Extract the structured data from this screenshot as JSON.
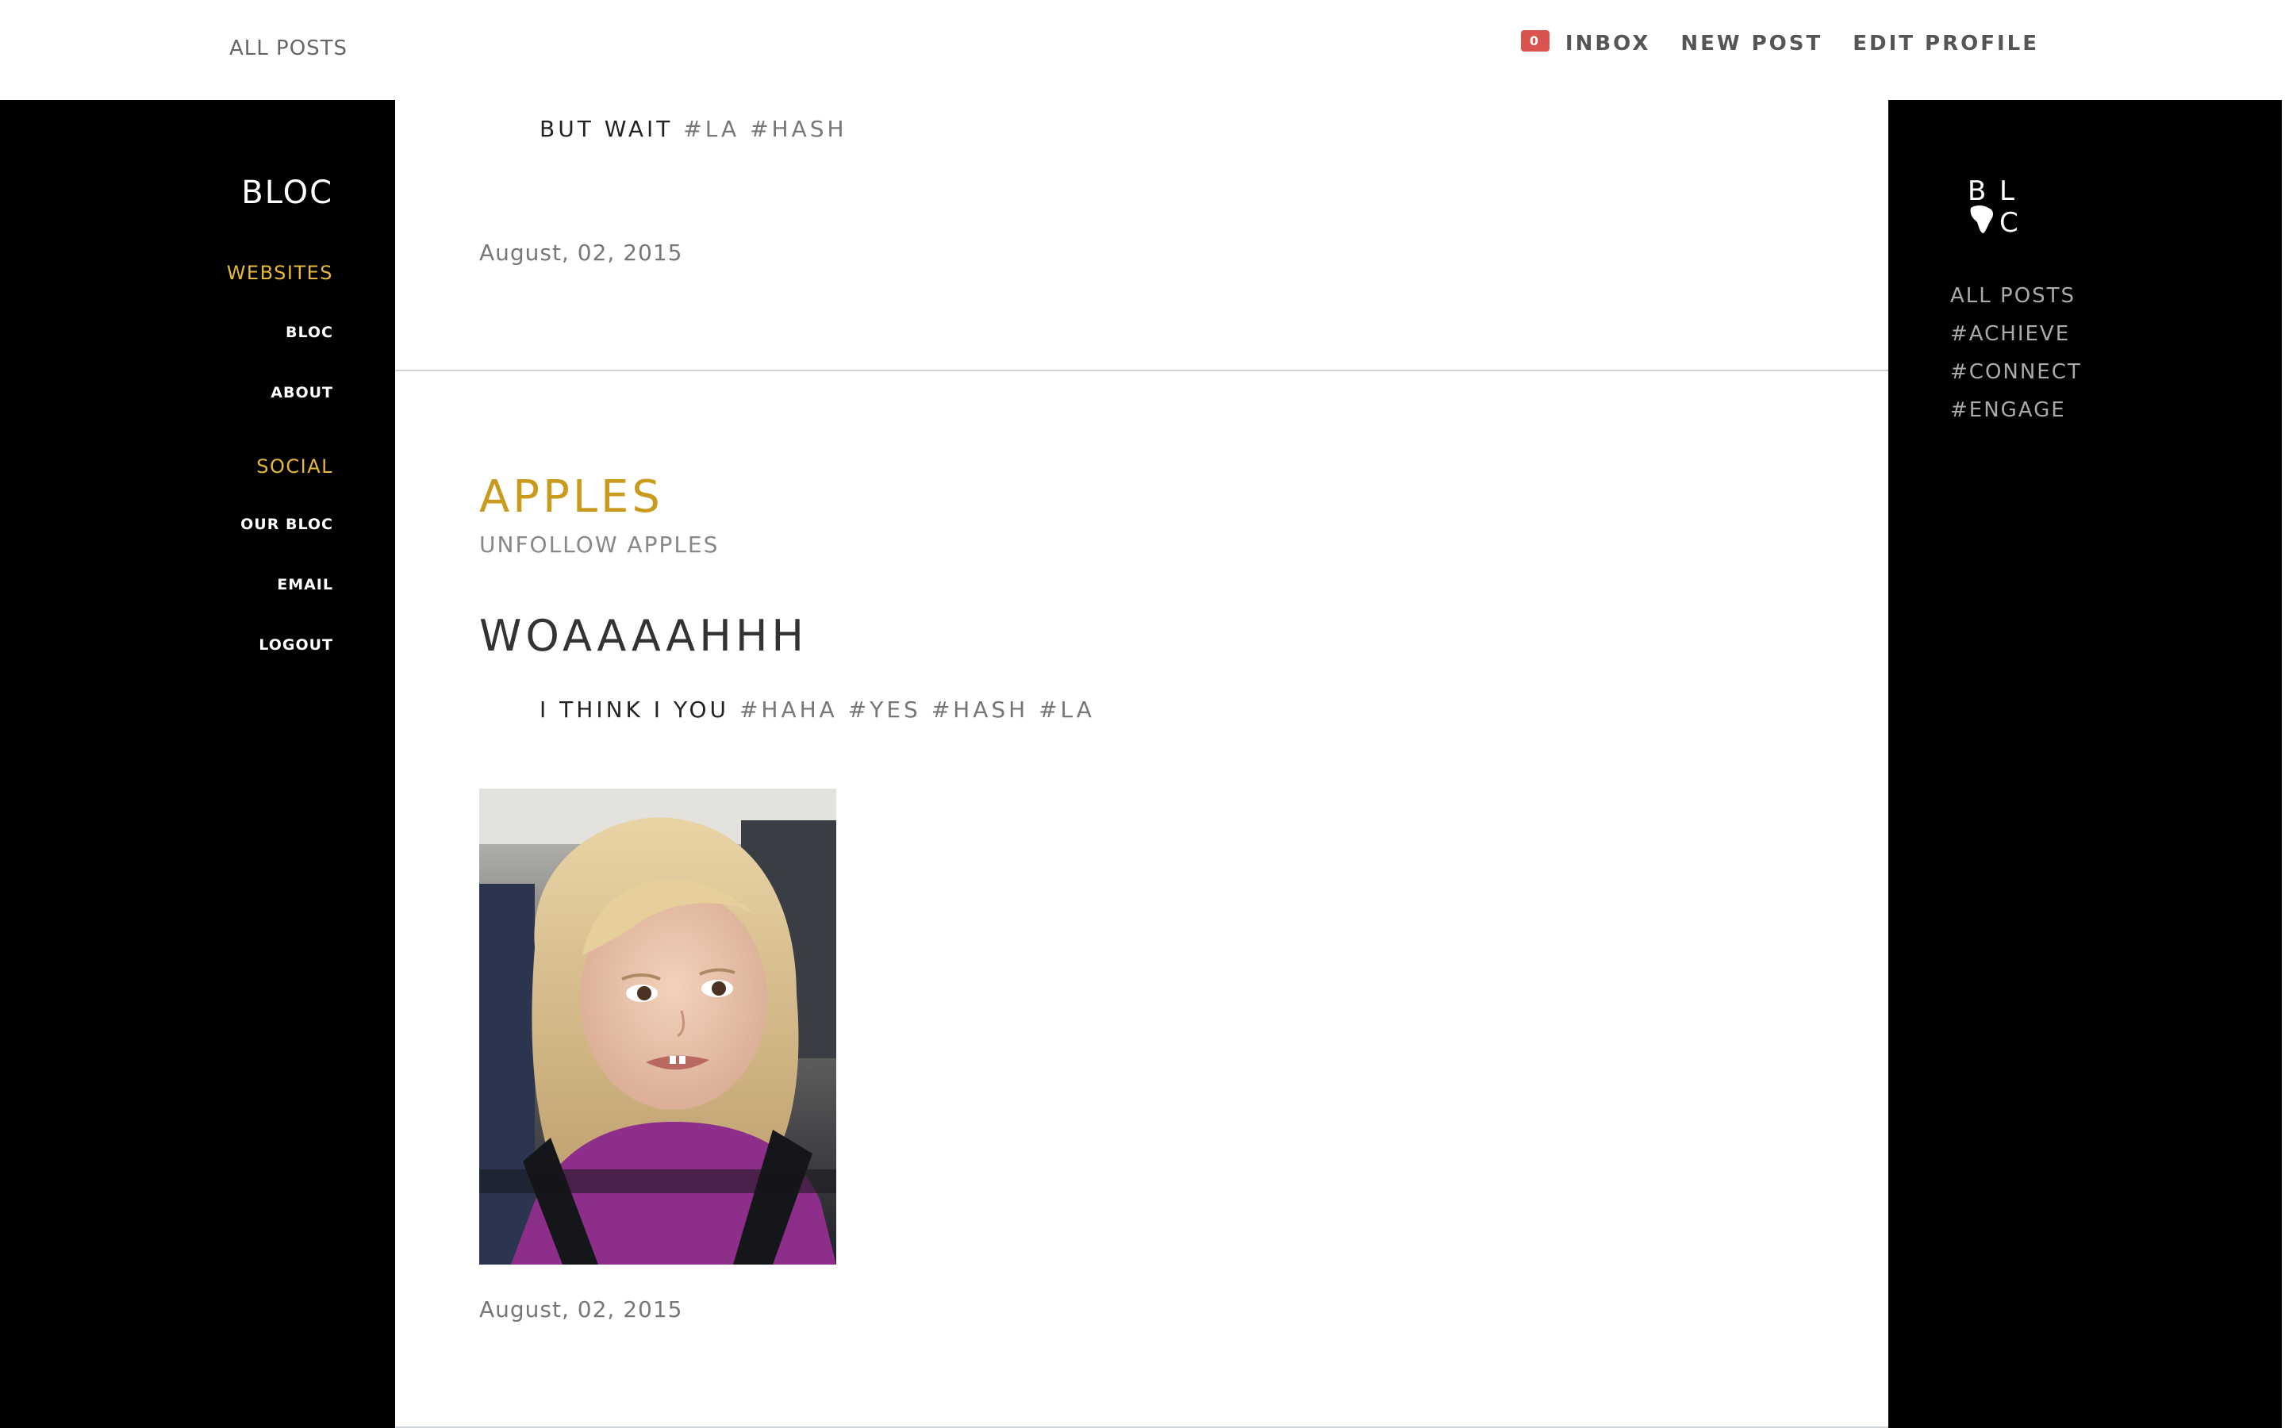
{
  "topbar": {
    "all_posts": "ALL POSTS",
    "inbox_count": "0",
    "inbox": "INBOX",
    "new_post": "NEW POST",
    "edit_profile": "EDIT PROFILE"
  },
  "left_sidebar": {
    "brand": "BLOC",
    "sections": [
      {
        "heading": "WEBSITES",
        "links": [
          "BLOC",
          "ABOUT"
        ]
      },
      {
        "heading": "SOCIAL",
        "links": [
          "OUR BLOC",
          "EMAIL",
          "LOGOUT"
        ]
      }
    ]
  },
  "posts": [
    {
      "caption": "BUT WAIT",
      "hashtags": [
        "#LA",
        "#HASH"
      ],
      "date": "August, 02, 2015"
    },
    {
      "author": "APPLES",
      "unfollow": "UNFOLLOW APPLES",
      "title": "WOAAAAHHH",
      "caption": "I THINK I YOU",
      "hashtags": [
        "#HAHA",
        "#YES",
        "#HASH",
        "#LA"
      ],
      "image": "photo of a young blonde girl in a car seat wearing a purple shirt",
      "date": "August, 02, 2015"
    }
  ],
  "right_sidebar": {
    "logo_letters": [
      "B",
      "L",
      "C"
    ],
    "links": [
      "ALL POSTS",
      "#ACHIEVE",
      "#CONNECT",
      "#ENGAGE"
    ]
  },
  "colors": {
    "accent_gold": "#e6b93a",
    "author_gold": "#c99a1b",
    "badge_red": "#d9534f",
    "sidebar_bg": "#000000"
  }
}
